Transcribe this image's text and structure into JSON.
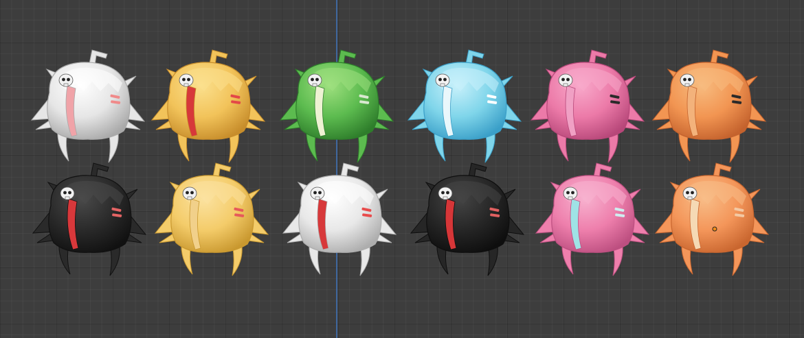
{
  "viewport": {
    "background": "#3d3d3d",
    "axis_color": "#3f6fae"
  },
  "models": [
    {
      "name": "white",
      "base": "#e6e6e6",
      "dark": "#a9a9a9",
      "light": "#ffffff",
      "strand": "#f0a3a8",
      "clip": "#f08a8a"
    },
    {
      "name": "yellow",
      "base": "#f2c35a",
      "dark": "#c78d2b",
      "light": "#fbe08e",
      "strand": "#d7383a",
      "clip": "#e34848"
    },
    {
      "name": "green",
      "base": "#5cbb4f",
      "dark": "#2e7d2b",
      "light": "#9fe07f",
      "strand": "#eef2d3",
      "clip": "#d9e8d0"
    },
    {
      "name": "blue",
      "base": "#7fd5ea",
      "dark": "#3a9fc8",
      "light": "#c9f1fb",
      "strand": "#e9f7fb",
      "clip": "#ffffff"
    },
    {
      "name": "pink",
      "base": "#ec7aa8",
      "dark": "#b74779",
      "light": "#f8aacb",
      "strand": "#f0a0c4",
      "clip": "#2a2a2a"
    },
    {
      "name": "orange",
      "base": "#f29552",
      "dark": "#c4622d",
      "light": "#f7bc80",
      "strand": "#f3b27b",
      "clip": "#2a2a2a"
    },
    {
      "name": "black",
      "base": "#2a2a2a",
      "dark": "#111111",
      "light": "#4a4a4a",
      "strand": "#d8383b",
      "clip": "#e46464"
    },
    {
      "name": "yellow-2",
      "base": "#f4cc6a",
      "dark": "#c9982f",
      "light": "#fbe2a0",
      "strand": "#f1d08a",
      "clip": "#e65a5a"
    },
    {
      "name": "white-2",
      "base": "#e8e8e8",
      "dark": "#adadad",
      "light": "#ffffff",
      "strand": "#d7383a",
      "clip": "#e84c4c"
    },
    {
      "name": "black-2",
      "base": "#262626",
      "dark": "#0e0e0e",
      "light": "#454545",
      "strand": "#d63638",
      "clip": "#e06060"
    },
    {
      "name": "pink-2",
      "base": "#ee7fac",
      "dark": "#bd4f80",
      "light": "#f7b2cf",
      "strand": "#9fe3e6",
      "clip": "#cfeef0"
    },
    {
      "name": "orange-2",
      "base": "#f4965a",
      "dark": "#c9662f",
      "light": "#f8bd88",
      "strand": "#f5d9b4",
      "clip": "#f3c9a4"
    }
  ]
}
